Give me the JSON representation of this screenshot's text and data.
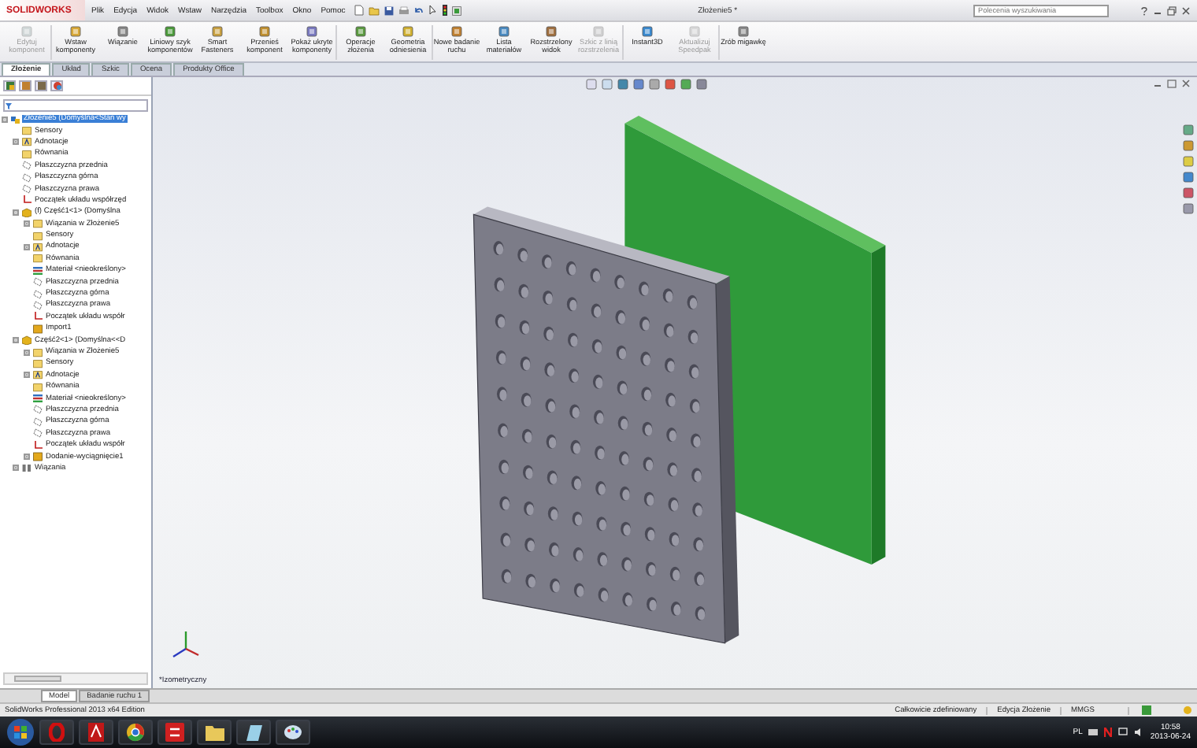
{
  "app": {
    "logo": "SOLIDWORKS",
    "menu": [
      "Plik",
      "Edycja",
      "Widok",
      "Wstaw",
      "Narzędzia",
      "Toolbox",
      "Okno",
      "Pomoc"
    ],
    "title": "Złożenie5 *",
    "search": {
      "placeholder": "Polecenia wyszukiwania"
    }
  },
  "ribbon": [
    {
      "label": "Edytuj komponent",
      "disabled": true
    },
    {
      "label": "Wstaw komponenty",
      "disabled": false
    },
    {
      "label": "Wiązanie",
      "disabled": false
    },
    {
      "label": "Liniowy szyk komponentów",
      "disabled": false
    },
    {
      "label": "Smart Fasteners",
      "disabled": false
    },
    {
      "label": "Przenieś komponent",
      "disabled": false
    },
    {
      "label": "Pokaż ukryte komponenty",
      "disabled": false
    },
    {
      "label": "Operacje złożenia",
      "disabled": false
    },
    {
      "label": "Geometria odniesienia",
      "disabled": false
    },
    {
      "label": "Nowe badanie ruchu",
      "disabled": false
    },
    {
      "label": "Lista materiałów",
      "disabled": false
    },
    {
      "label": "Rozstrzelony widok",
      "disabled": false
    },
    {
      "label": "Szkic z linią rozstrzelenia",
      "disabled": true
    },
    {
      "label": "Instant3D",
      "disabled": false
    },
    {
      "label": "Aktualizuj Speedpak",
      "disabled": true
    },
    {
      "label": "Zrób migawkę",
      "disabled": false
    }
  ],
  "command_tabs": [
    {
      "label": "Złożenie",
      "selected": true
    },
    {
      "label": "Układ",
      "selected": false
    },
    {
      "label": "Szkic",
      "selected": false
    },
    {
      "label": "Ocena",
      "selected": false
    },
    {
      "label": "Produkty Office",
      "selected": false
    }
  ],
  "feature_tree": [
    {
      "label": "Złożenie5 (Domyślna<Stan wy",
      "kind": "assembly",
      "selected": true,
      "expanded": true,
      "children": [
        {
          "label": "Sensory",
          "kind": "folder",
          "selected": false
        },
        {
          "label": "Adnotacje",
          "kind": "annotation",
          "selected": false,
          "expanded": false
        },
        {
          "label": "Równania",
          "kind": "folder",
          "selected": false
        },
        {
          "label": "Płaszczyzna przednia",
          "kind": "plane",
          "selected": false
        },
        {
          "label": "Płaszczyzna górna",
          "kind": "plane",
          "selected": false
        },
        {
          "label": "Płaszczyzna prawa",
          "kind": "plane",
          "selected": false
        },
        {
          "label": "Początek układu współrzęd",
          "kind": "origin",
          "selected": false
        },
        {
          "label": "(f) Część1<1> (Domyślna",
          "kind": "part",
          "selected": false,
          "expanded": true,
          "children": [
            {
              "label": "Wiązania w Złożenie5",
              "kind": "folder",
              "selected": false,
              "expanded": false
            },
            {
              "label": "Sensory",
              "kind": "folder",
              "selected": false
            },
            {
              "label": "Adnotacje",
              "kind": "annotation",
              "selected": false,
              "expanded": false
            },
            {
              "label": "Równania",
              "kind": "folder",
              "selected": false
            },
            {
              "label": "Materiał <nieokreślony>",
              "kind": "material",
              "selected": false
            },
            {
              "label": "Płaszczyzna przednia",
              "kind": "plane",
              "selected": false
            },
            {
              "label": "Płaszczyzna górna",
              "kind": "plane",
              "selected": false
            },
            {
              "label": "Płaszczyzna prawa",
              "kind": "plane",
              "selected": false
            },
            {
              "label": "Początek układu współr",
              "kind": "origin",
              "selected": false
            },
            {
              "label": "Import1",
              "kind": "feature",
              "selected": false
            }
          ]
        },
        {
          "label": "Część2<1> (Domyślna<<D",
          "kind": "part",
          "selected": false,
          "expanded": true,
          "children": [
            {
              "label": "Wiązania w Złożenie5",
              "kind": "folder",
              "selected": false,
              "expanded": false
            },
            {
              "label": "Sensory",
              "kind": "folder",
              "selected": false
            },
            {
              "label": "Adnotacje",
              "kind": "annotation",
              "selected": false,
              "expanded": false
            },
            {
              "label": "Równania",
              "kind": "folder",
              "selected": false
            },
            {
              "label": "Materiał <nieokreślony>",
              "kind": "material",
              "selected": false
            },
            {
              "label": "Płaszczyzna przednia",
              "kind": "plane",
              "selected": false
            },
            {
              "label": "Płaszczyzna górna",
              "kind": "plane",
              "selected": false
            },
            {
              "label": "Płaszczyzna prawa",
              "kind": "plane",
              "selected": false
            },
            {
              "label": "Początek układu współr",
              "kind": "origin",
              "selected": false
            },
            {
              "label": "Dodanie-wyciągnięcie1",
              "kind": "feature",
              "selected": false,
              "expanded": false
            }
          ]
        },
        {
          "label": "Wiązania",
          "kind": "mates",
          "selected": false,
          "expanded": false
        }
      ]
    }
  ],
  "viewport": {
    "view_label": "*Izometryczny"
  },
  "bottom_tabs": [
    {
      "label": "Model",
      "selected": true
    },
    {
      "label": "Badanie ruchu 1",
      "selected": false
    }
  ],
  "status_bar": {
    "product": "SolidWorks Professional 2013 x64 Edition",
    "fields": [
      "Całkowicie zdefiniowany",
      "Edycja Złożenie",
      "MMGS"
    ]
  },
  "taskbar": {
    "language": "PL",
    "time": "10:58",
    "date": "2013-06-24"
  }
}
